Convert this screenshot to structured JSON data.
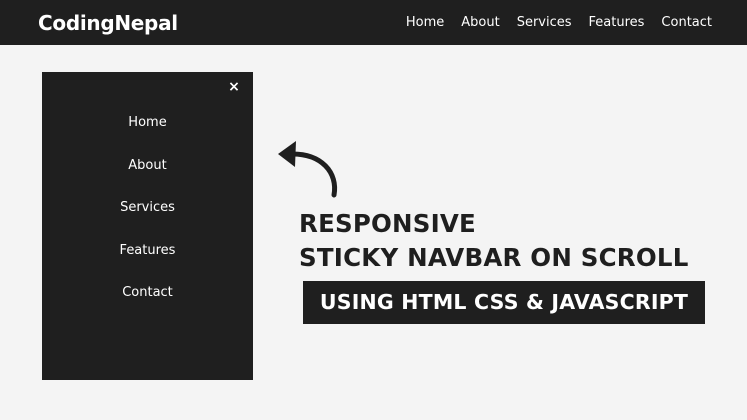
{
  "navbar": {
    "logo": "CodingNepal",
    "links": [
      "Home",
      "About",
      "Services",
      "Features",
      "Contact"
    ]
  },
  "side_menu": {
    "close_icon": "×",
    "links": [
      "Home",
      "About",
      "Services",
      "Features",
      "Contact"
    ]
  },
  "headline": {
    "line1": "RESPONSIVE",
    "line2": "STICKY NAVBAR ON SCROLL"
  },
  "banner": {
    "text": "USING HTML CSS & JAVASCRIPT"
  },
  "colors": {
    "dark": "#1f1f1f",
    "background": "#f4f4f4",
    "text_light": "#ffffff"
  }
}
